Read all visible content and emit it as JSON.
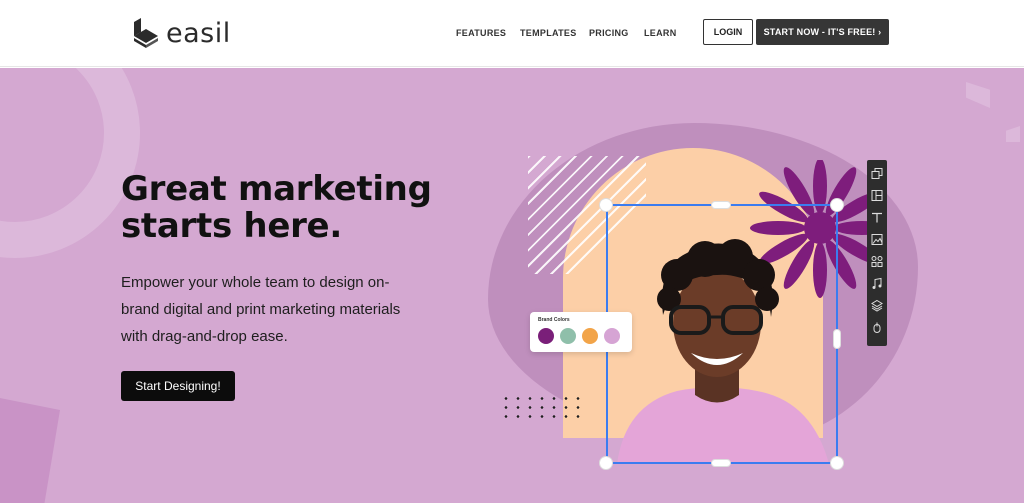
{
  "header": {
    "logo_text": "easil",
    "nav": [
      {
        "label": "FEATURES"
      },
      {
        "label": "TEMPLATES"
      },
      {
        "label": "PRICING"
      },
      {
        "label": "LEARN"
      }
    ],
    "login_label": "LOGIN",
    "start_label": "START NOW - IT'S FREE! ›"
  },
  "hero": {
    "headline_line1": "Great marketing",
    "headline_line2": "starts here.",
    "subtext": "Empower your whole team to design on-brand digital and print marketing materials with drag-and-drop ease.",
    "cta_label": "Start Designing!",
    "background_color": "#d4a8d1"
  },
  "brand_colors": {
    "title": "Brand Colors",
    "swatches": [
      "#7a1f79",
      "#8fbfaa",
      "#f2a449",
      "#d6a4d4"
    ]
  },
  "toolbar": {
    "icons": [
      "resize-icon",
      "layout-icon",
      "text-icon",
      "image-icon",
      "elements-icon",
      "music-icon",
      "layers-icon",
      "animation-icon"
    ]
  }
}
